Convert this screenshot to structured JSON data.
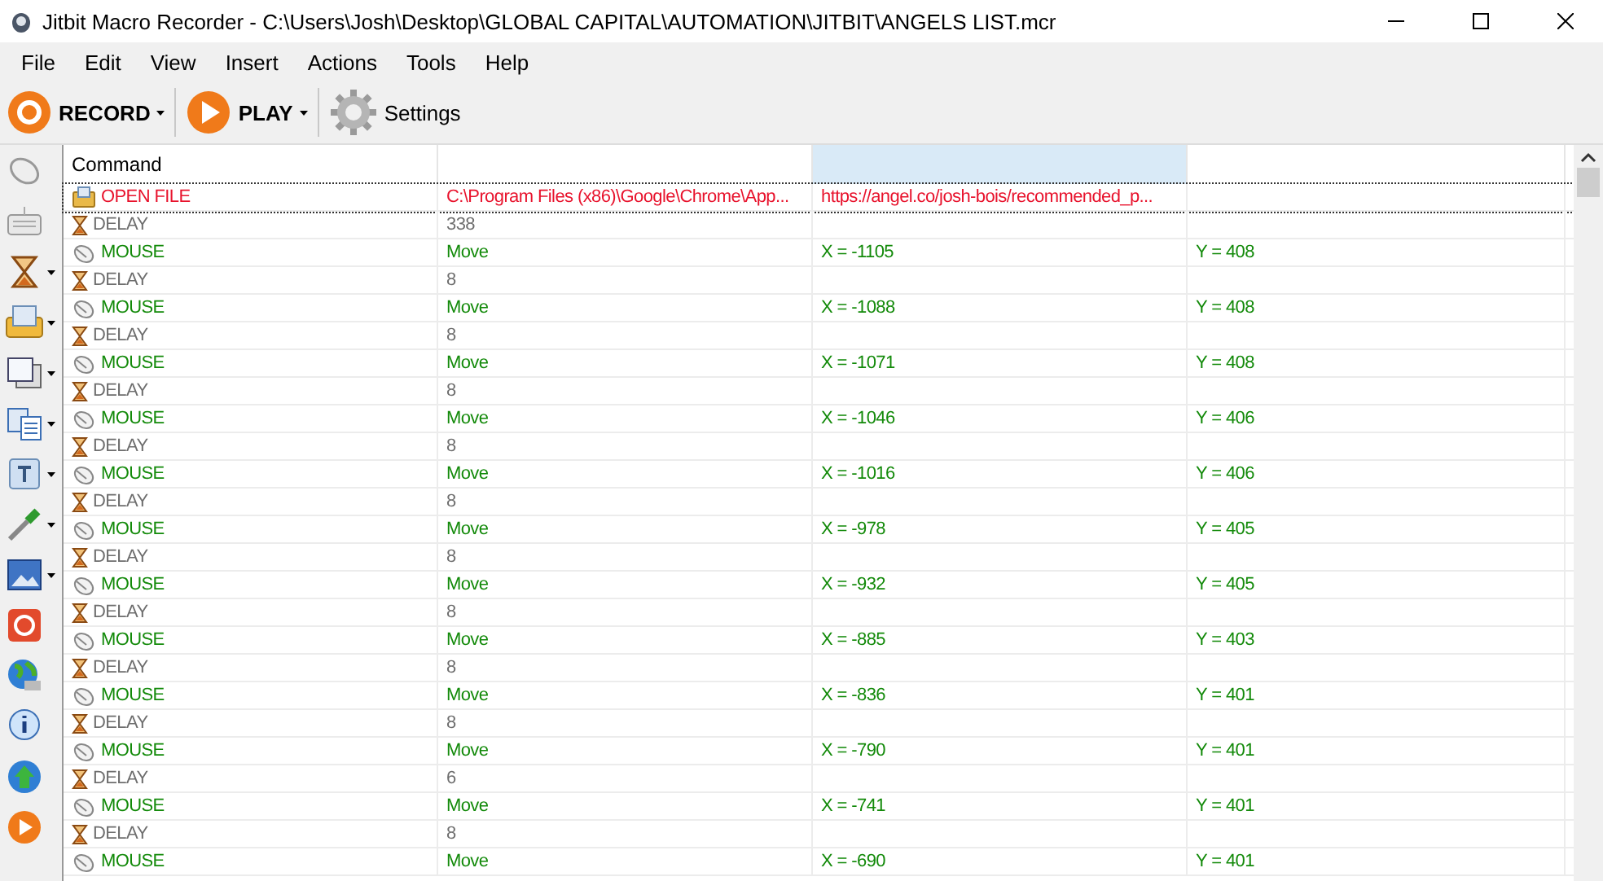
{
  "window": {
    "title": "Jitbit Macro Recorder - C:\\Users\\Josh\\Desktop\\GLOBAL CAPITAL\\AUTOMATION\\JITBIT\\ANGELS LIST.mcr"
  },
  "menu": [
    "File",
    "Edit",
    "View",
    "Insert",
    "Actions",
    "Tools",
    "Help"
  ],
  "toolbar": [
    {
      "kind": "record",
      "label": "RECORD",
      "dropdown": true
    },
    {
      "kind": "play",
      "label": "PLAY",
      "dropdown": true
    },
    {
      "kind": "settings",
      "label": "Settings",
      "dropdown": false
    }
  ],
  "side_tools": [
    {
      "kind": "mouse",
      "dropdown": false
    },
    {
      "kind": "keyboard",
      "dropdown": false
    },
    {
      "kind": "hourglass",
      "dropdown": true
    },
    {
      "kind": "file",
      "dropdown": true
    },
    {
      "kind": "window",
      "dropdown": true
    },
    {
      "kind": "copy",
      "dropdown": true
    },
    {
      "kind": "text",
      "dropdown": true
    },
    {
      "kind": "eyedropper",
      "dropdown": true
    },
    {
      "kind": "image",
      "dropdown": true
    },
    {
      "kind": "stop",
      "dropdown": false
    },
    {
      "kind": "globe",
      "dropdown": false
    },
    {
      "kind": "info",
      "dropdown": false
    },
    {
      "kind": "upload",
      "dropdown": false
    },
    {
      "kind": "play",
      "dropdown": false
    }
  ],
  "table": {
    "columns": [
      {
        "label": "Command",
        "highlighted": false
      },
      {
        "highlighted": false
      },
      {
        "highlighted": true
      },
      {
        "highlighted": false
      }
    ],
    "rows": [
      {
        "kind": "file",
        "command": "OPEN FILE",
        "cells": [
          "C:\\Program Files (x86)\\Google\\Chrome\\App...",
          "https://angel.co/josh-bois/recommended_p..."
        ],
        "focused": true
      },
      {
        "kind": "delay",
        "command": "DELAY",
        "cells": [
          "338"
        ],
        "focused": false
      },
      {
        "kind": "mouse",
        "command": "MOUSE",
        "cells": [
          "Move",
          "X = -1105",
          "Y = 408"
        ],
        "focused": false
      },
      {
        "kind": "delay",
        "command": "DELAY",
        "cells": [
          "8"
        ],
        "focused": false
      },
      {
        "kind": "mouse",
        "command": "MOUSE",
        "cells": [
          "Move",
          "X = -1088",
          "Y = 408"
        ],
        "focused": false
      },
      {
        "kind": "delay",
        "command": "DELAY",
        "cells": [
          "8"
        ],
        "focused": false
      },
      {
        "kind": "mouse",
        "command": "MOUSE",
        "cells": [
          "Move",
          "X = -1071",
          "Y = 408"
        ],
        "focused": false
      },
      {
        "kind": "delay",
        "command": "DELAY",
        "cells": [
          "8"
        ],
        "focused": false
      },
      {
        "kind": "mouse",
        "command": "MOUSE",
        "cells": [
          "Move",
          "X = -1046",
          "Y = 406"
        ],
        "focused": false
      },
      {
        "kind": "delay",
        "command": "DELAY",
        "cells": [
          "8"
        ],
        "focused": false
      },
      {
        "kind": "mouse",
        "command": "MOUSE",
        "cells": [
          "Move",
          "X = -1016",
          "Y = 406"
        ],
        "focused": false
      },
      {
        "kind": "delay",
        "command": "DELAY",
        "cells": [
          "8"
        ],
        "focused": false
      },
      {
        "kind": "mouse",
        "command": "MOUSE",
        "cells": [
          "Move",
          "X = -978",
          "Y = 405"
        ],
        "focused": false
      },
      {
        "kind": "delay",
        "command": "DELAY",
        "cells": [
          "8"
        ],
        "focused": false
      },
      {
        "kind": "mouse",
        "command": "MOUSE",
        "cells": [
          "Move",
          "X = -932",
          "Y = 405"
        ],
        "focused": false
      },
      {
        "kind": "delay",
        "command": "DELAY",
        "cells": [
          "8"
        ],
        "focused": false
      },
      {
        "kind": "mouse",
        "command": "MOUSE",
        "cells": [
          "Move",
          "X = -885",
          "Y = 403"
        ],
        "focused": false
      },
      {
        "kind": "delay",
        "command": "DELAY",
        "cells": [
          "8"
        ],
        "focused": false
      },
      {
        "kind": "mouse",
        "command": "MOUSE",
        "cells": [
          "Move",
          "X = -836",
          "Y = 401"
        ],
        "focused": false
      },
      {
        "kind": "delay",
        "command": "DELAY",
        "cells": [
          "8"
        ],
        "focused": false
      },
      {
        "kind": "mouse",
        "command": "MOUSE",
        "cells": [
          "Move",
          "X = -790",
          "Y = 401"
        ],
        "focused": false
      },
      {
        "kind": "delay",
        "command": "DELAY",
        "cells": [
          "6"
        ],
        "focused": false
      },
      {
        "kind": "mouse",
        "command": "MOUSE",
        "cells": [
          "Move",
          "X = -741",
          "Y = 401"
        ],
        "focused": false
      },
      {
        "kind": "delay",
        "command": "DELAY",
        "cells": [
          "8"
        ],
        "focused": false
      },
      {
        "kind": "mouse",
        "command": "MOUSE",
        "cells": [
          "Move",
          "X = -690",
          "Y = 401"
        ],
        "focused": false
      }
    ]
  }
}
